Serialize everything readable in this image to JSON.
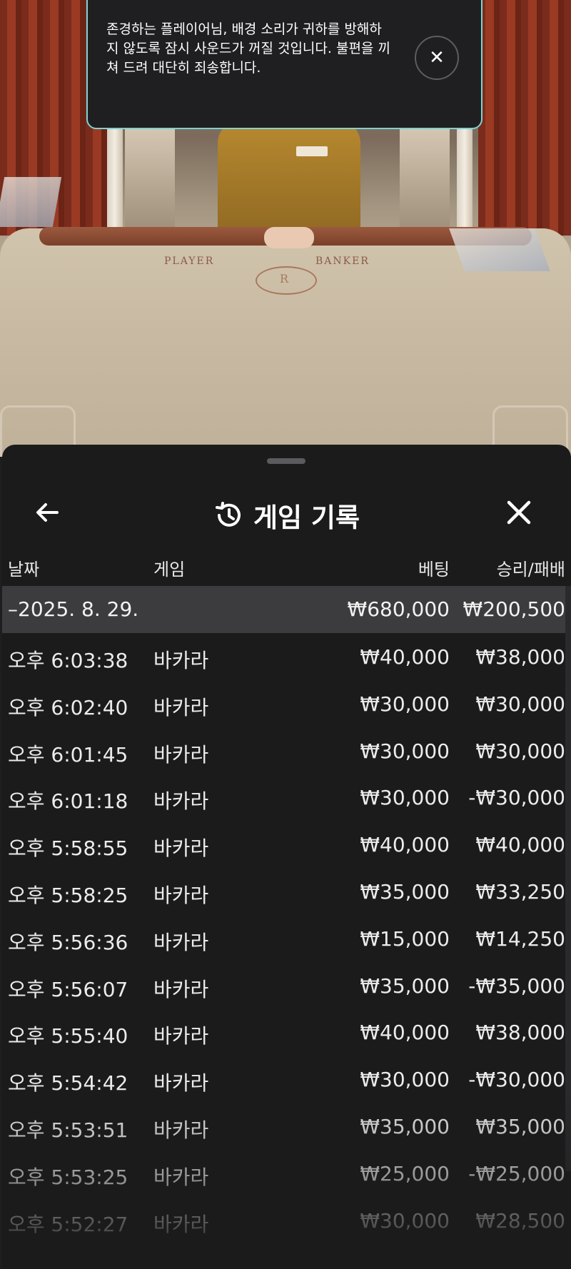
{
  "table_scene": {
    "player_label": "PLAYER",
    "banker_label": "BANKER",
    "logo_letter": "R"
  },
  "notice": {
    "text": "존경하는 플레이어님, 배경 소리가 귀하를 방해하지 않도록 잠시 사운드가 꺼질 것입니다. 불편을 끼쳐 드려 대단히 죄송합니다.",
    "close_symbol": "✕"
  },
  "history": {
    "title": "게임 기록",
    "columns": {
      "date": "날짜",
      "game": "게임",
      "bet": "베팅",
      "result": "승리/패배"
    },
    "date_group": {
      "label": "–2025. 8. 29.",
      "bet_total": "₩680,000",
      "result_total": "₩200,500"
    },
    "rows": [
      {
        "time": "오후 6:03:38",
        "game": "바카라",
        "bet": "₩40,000",
        "result": "₩38,000"
      },
      {
        "time": "오후 6:02:40",
        "game": "바카라",
        "bet": "₩30,000",
        "result": "₩30,000"
      },
      {
        "time": "오후 6:01:45",
        "game": "바카라",
        "bet": "₩30,000",
        "result": "₩30,000"
      },
      {
        "time": "오후 6:01:18",
        "game": "바카라",
        "bet": "₩30,000",
        "result": "-₩30,000"
      },
      {
        "time": "오후 5:58:55",
        "game": "바카라",
        "bet": "₩40,000",
        "result": "₩40,000"
      },
      {
        "time": "오후 5:58:25",
        "game": "바카라",
        "bet": "₩35,000",
        "result": "₩33,250"
      },
      {
        "time": "오후 5:56:36",
        "game": "바카라",
        "bet": "₩15,000",
        "result": "₩14,250"
      },
      {
        "time": "오후 5:56:07",
        "game": "바카라",
        "bet": "₩35,000",
        "result": "-₩35,000"
      },
      {
        "time": "오후 5:55:40",
        "game": "바카라",
        "bet": "₩40,000",
        "result": "₩38,000"
      },
      {
        "time": "오후 5:54:42",
        "game": "바카라",
        "bet": "₩30,000",
        "result": "-₩30,000"
      },
      {
        "time": "오후 5:53:51",
        "game": "바카라",
        "bet": "₩35,000",
        "result": "₩35,000"
      },
      {
        "time": "오후 5:53:25",
        "game": "바카라",
        "bet": "₩25,000",
        "result": "-₩25,000"
      },
      {
        "time": "오후 5:52:27",
        "game": "바카라",
        "bet": "₩30,000",
        "result": "₩28,500"
      }
    ]
  },
  "icons": {
    "back": "arrow-left-icon",
    "history": "history-clock-icon",
    "close": "close-icon",
    "notice_close": "close-icon"
  },
  "colors": {
    "sheet_bg": "#1b1b1c",
    "date_row_bg": "#3c3c3e",
    "notice_border": "#7fd1cf",
    "text": "#ececec"
  }
}
